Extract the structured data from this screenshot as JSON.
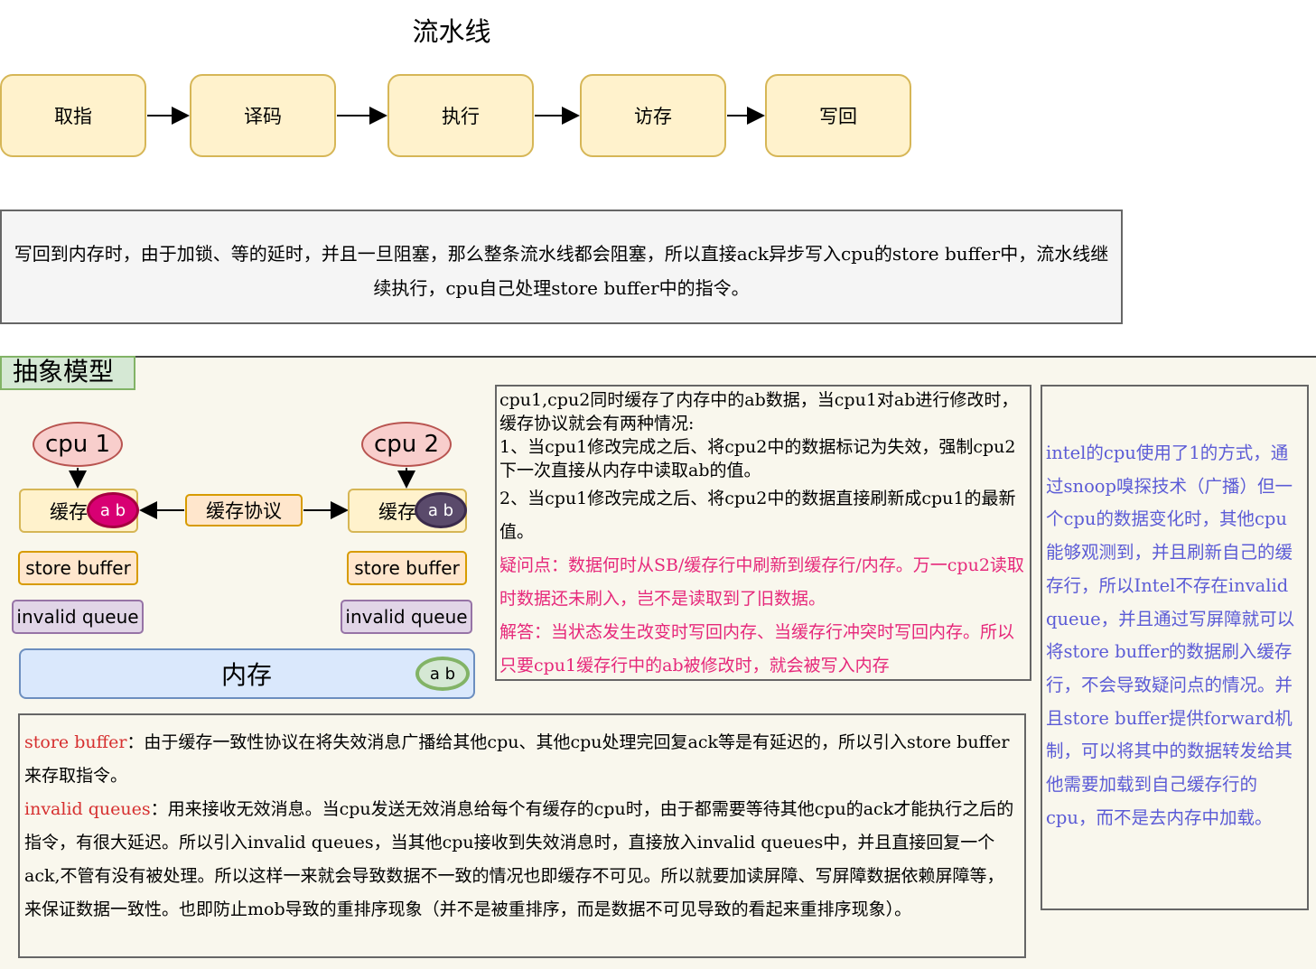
{
  "title": "流水线",
  "pipeline": {
    "stages": [
      "取指",
      "译码",
      "执行",
      "访存",
      "写回"
    ]
  },
  "note_text": "写回到内存时，由于加锁、等的延时，并且一旦阻塞，那么整条流水线都会阻塞，所以直接ack异步写入cpu的store buffer中，流水线继续执行，cpu自己处理store buffer中的指令。",
  "section_title": "抽象模型",
  "model": {
    "cpu1": "cpu 1",
    "cpu2": "cpu 2",
    "cache_label": "缓存",
    "ab": "a b",
    "protocol": "缓存协议",
    "store_buffer": "store buffer",
    "invalid_queue": "invalid queue",
    "memory": "内存"
  },
  "explain": {
    "p1": "cpu1,cpu2同时缓存了内存中的ab数据，当cpu1对ab进行修改时，缓存协议就会有两种情况:",
    "p2": "1、当cpu1修改完成之后、将cpu2中的数据标记为失效，强制cpu2下一次直接从内存中读取ab的值。",
    "p3": "2、当cpu1修改完成之后、将cpu2中的数据直接刷新成cpu1的最新值。",
    "q": "疑问点：数据何时从SB/缓存行中刷新到缓存行/内存。万一cpu2读取时数据还未刷入，岂不是读取到了旧数据。",
    "a": "解答：当状态发生改变时写回内存、当缓存行冲突时写回内存。所以只要cpu1缓存行中的ab被修改时，就会被写入内存"
  },
  "definitions": {
    "sb_term": "store buffer",
    "sb_text": "：由于缓存一致性协议在将失效消息广播给其他cpu、其他cpu处理完回复ack等是有延迟的，所以引入store buffer来存取指令。",
    "iq_term": "invalid queues",
    "iq_text": "：用来接收无效消息。当cpu发送无效消息给每个有缓存的cpu时，由于都需要等待其他cpu的ack才能执行之后的指令，有很大延迟。所以引入invalid queues，当其他cpu接收到失效消息时，直接放入invalid queues中，并且直接回复一个ack,不管有没有被处理。所以这样一来就会导致数据不一致的情况也即缓存不可见。所以就要加读屏障、写屏障数据依赖屏障等，来保证数据一致性。也即防止mob导致的重排序现象（并不是被重排序，而是数据不可见导致的看起来重排序现象）。"
  },
  "intel_note": "intel的cpu使用了1的方式，通过snoop嗅探技术（广播）但一个cpu的数据变化时，其他cpu能够观测到，并且刷新自己的缓存行，所以Intel不存在invalid queue，并且通过写屏障就可以将store buffer的数据刷入缓存行，不会导致疑问点的情况。并且store buffer提供forward机制，可以将其中的数据转发给其他需要加载到自己缓存行的cpu，而不是去内存中加载。",
  "colors": {
    "stage_fill": "#fff2cc",
    "stage_stroke": "#d6b656",
    "cpu_fill": "#f8cecc",
    "mem_fill": "#dae8fc",
    "sb_fill": "#ffe6cc",
    "iq_fill": "#e1d5e7",
    "pink_text": "#e6287a",
    "blue_text": "#5b5bd6"
  }
}
